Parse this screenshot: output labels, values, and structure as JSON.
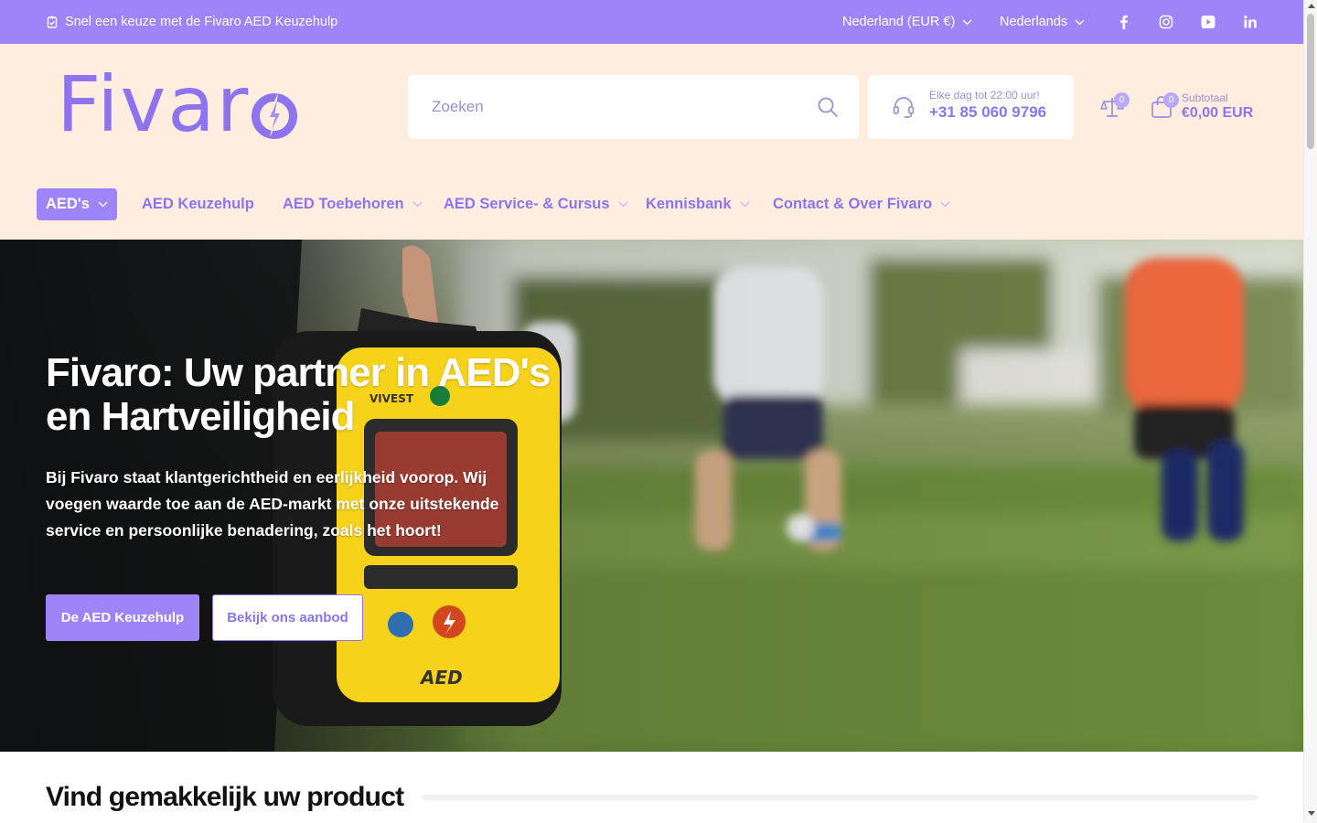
{
  "topbar": {
    "promo_text": "Snel een keuze met de Fivaro AED Keuzehulp",
    "country": "Nederland (EUR €)",
    "language": "Nederlands",
    "social": [
      "facebook-icon",
      "instagram-icon",
      "youtube-icon",
      "linkedin-icon"
    ]
  },
  "header": {
    "logo_text": "Fivar",
    "search_placeholder": "Zoeken",
    "phone_hours": "Elke dag tot 22:00 uur!",
    "phone_number": "+31 85 060 9796",
    "compare_count": "0",
    "cart_count": "0",
    "cart_label": "Subtotaal",
    "cart_value": "€0,00 EUR"
  },
  "nav": {
    "items": [
      {
        "label": "AED's",
        "dropdown": true,
        "active": true
      },
      {
        "label": "AED Keuzehulp",
        "dropdown": false
      },
      {
        "label": "AED Toebehoren",
        "dropdown": true
      },
      {
        "label": "AED Service- & Cursus",
        "dropdown": true
      },
      {
        "label": "Kennisbank",
        "dropdown": true
      },
      {
        "label": "Contact & Over Fivaro",
        "dropdown": true
      }
    ]
  },
  "hero": {
    "title": "Fivaro: Uw partner in AED's en Hartveiligheid",
    "text": "Bij Fivaro staat klantgerichtheid en eerlijkheid voorop. Wij voegen waarde toe aan de AED-markt met onze uitstekende service en persoonlijke benadering, zoals het hoort!",
    "primary_button": "De AED Keuzehulp",
    "secondary_button": "Bekijk ons aanbod",
    "device_brand": "VIVEST",
    "device_label": "AED"
  },
  "section": {
    "title": "Vind gemakkelijk uw product"
  },
  "colors": {
    "brand": "#9d85f7",
    "brand_dark": "#8d74ee",
    "header_bg": "#ffeee0"
  }
}
